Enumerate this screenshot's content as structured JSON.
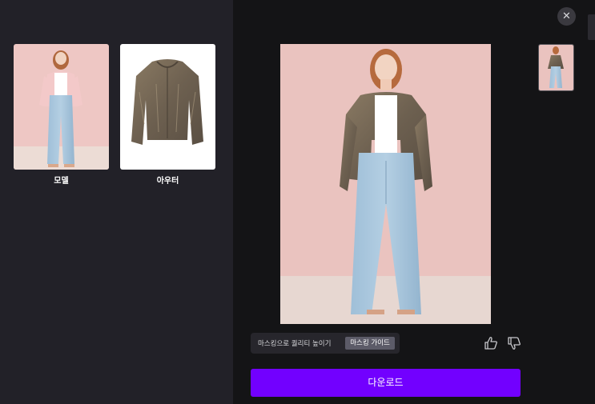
{
  "sources": [
    {
      "label": "모델"
    },
    {
      "label": "아우터"
    }
  ],
  "close_icon": "close-icon",
  "mask_bar": {
    "text": "마스킹으로 퀄리티 높이기",
    "guide_label": "마스킹 가이드"
  },
  "feedback": {
    "like_icon": "thumbs-up-icon",
    "dislike_icon": "thumbs-down-icon"
  },
  "download_label": "다운로드",
  "colors": {
    "accent": "#7200ff",
    "left_panel_bg": "#222128",
    "right_panel_bg": "#141416"
  }
}
